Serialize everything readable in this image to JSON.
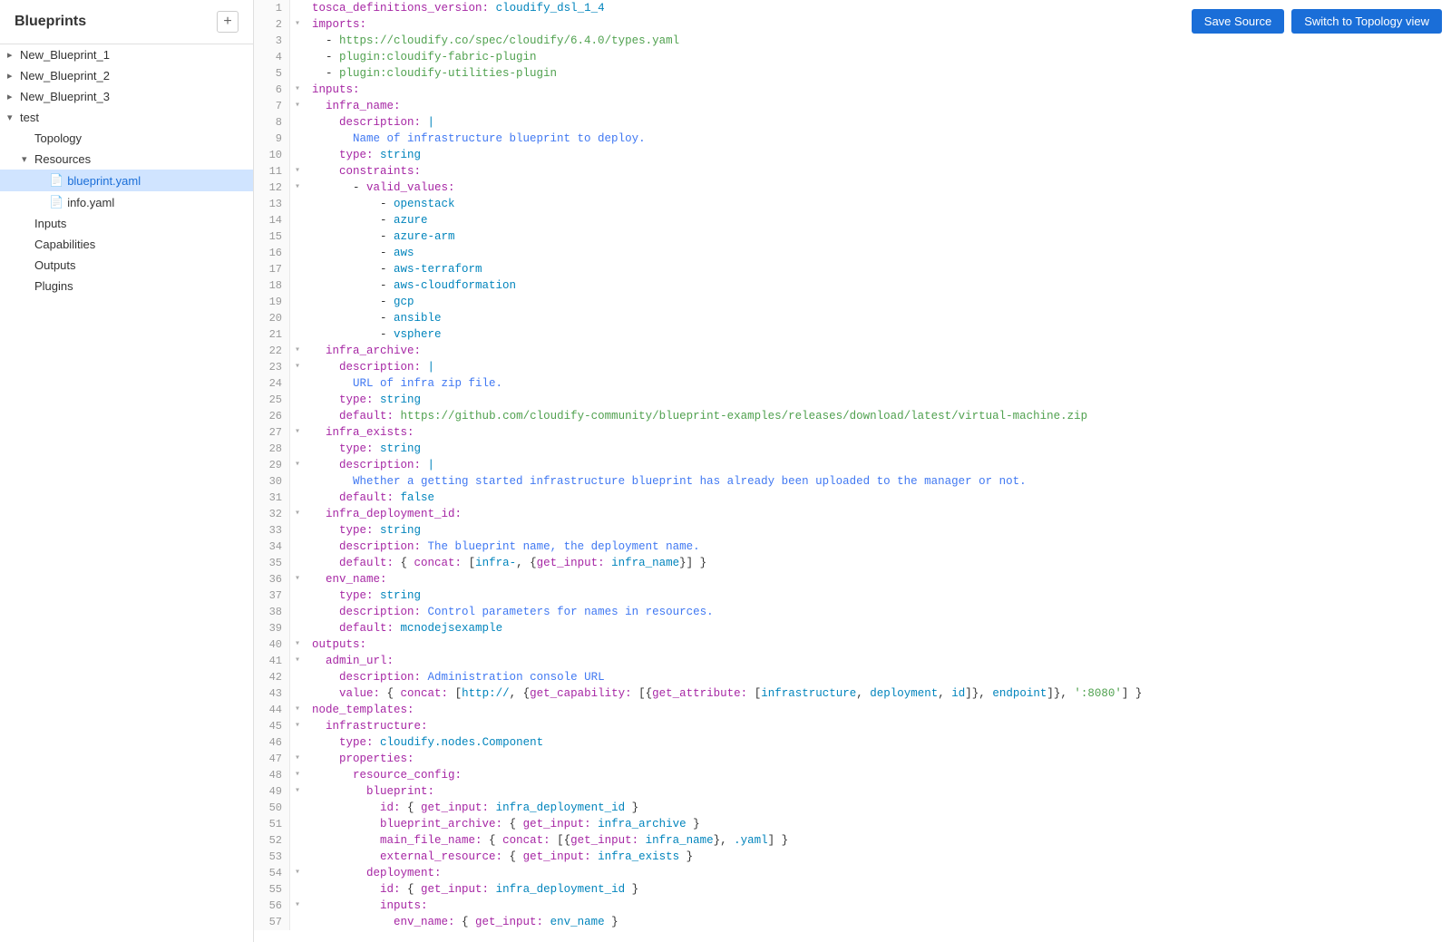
{
  "sidebar": {
    "title": "Blueprints",
    "add_label": "+",
    "items": [
      {
        "id": "new-bp-1",
        "label": "New_Blueprint_1",
        "level": 0,
        "expanded": false,
        "type": "blueprint"
      },
      {
        "id": "new-bp-2",
        "label": "New_Blueprint_2",
        "level": 0,
        "expanded": false,
        "type": "blueprint"
      },
      {
        "id": "new-bp-3",
        "label": "New_Blueprint_3",
        "level": 0,
        "expanded": false,
        "type": "blueprint"
      },
      {
        "id": "test",
        "label": "test",
        "level": 0,
        "expanded": true,
        "type": "blueprint"
      },
      {
        "id": "topology",
        "label": "Topology",
        "level": 1,
        "type": "page"
      },
      {
        "id": "resources",
        "label": "Resources",
        "level": 1,
        "expanded": true,
        "type": "folder"
      },
      {
        "id": "blueprint-yaml",
        "label": "blueprint.yaml",
        "level": 2,
        "type": "file",
        "selected": true
      },
      {
        "id": "info-yaml",
        "label": "info.yaml",
        "level": 2,
        "type": "file"
      },
      {
        "id": "inputs",
        "label": "Inputs",
        "level": 1,
        "type": "page"
      },
      {
        "id": "capabilities",
        "label": "Capabilities",
        "level": 1,
        "type": "page"
      },
      {
        "id": "outputs",
        "label": "Outputs",
        "level": 1,
        "type": "page"
      },
      {
        "id": "plugins",
        "label": "Plugins",
        "level": 1,
        "type": "page"
      }
    ]
  },
  "toolbar": {
    "save_label": "Save Source",
    "topology_label": "Switch to Topology view"
  },
  "code": {
    "lines": [
      {
        "n": 1,
        "fold": false,
        "text": "tosca_definitions_version: cloudify_dsl_1_4",
        "html": "<span class='kw'>tosca_definitions_version:</span> <span class='val'>cloudify_dsl_1_4</span>"
      },
      {
        "n": 2,
        "fold": true,
        "text": "imports:",
        "html": "<span class='kw'>imports:</span>"
      },
      {
        "n": 3,
        "fold": false,
        "text": "  - https://cloudify.co/spec/cloudify/6.4.0/types.yaml",
        "html": "  - <span class='str'>https://cloudify.co/spec/cloudify/6.4.0/types.yaml</span>"
      },
      {
        "n": 4,
        "fold": false,
        "text": "  - plugin:cloudify-fabric-plugin",
        "html": "  - <span class='str'>plugin:cloudify-fabric-plugin</span>"
      },
      {
        "n": 5,
        "fold": false,
        "text": "  - plugin:cloudify-utilities-plugin",
        "html": "  - <span class='str'>plugin:cloudify-utilities-plugin</span>"
      },
      {
        "n": 6,
        "fold": true,
        "text": "inputs:",
        "html": "<span class='kw'>inputs:</span>"
      },
      {
        "n": 7,
        "fold": true,
        "text": "  infra_name:",
        "html": "  <span class='kw'>infra_name:</span>"
      },
      {
        "n": 8,
        "fold": false,
        "text": "    description: |",
        "html": "    <span class='kw'>description:</span> <span class='val'>|</span>"
      },
      {
        "n": 9,
        "fold": false,
        "text": "      Name of infrastructure blueprint to deploy.",
        "html": "      <span class='blue'>Name of infrastructure blueprint to deploy.</span>"
      },
      {
        "n": 10,
        "fold": false,
        "text": "    type: string",
        "html": "    <span class='kw'>type:</span> <span class='val'>string</span>"
      },
      {
        "n": 11,
        "fold": true,
        "text": "    constraints:",
        "html": "    <span class='kw'>constraints:</span>"
      },
      {
        "n": 12,
        "fold": true,
        "text": "      - valid_values:",
        "html": "      - <span class='kw'>valid_values:</span>"
      },
      {
        "n": 13,
        "fold": false,
        "text": "          - openstack",
        "html": "          - <span class='val'>openstack</span>"
      },
      {
        "n": 14,
        "fold": false,
        "text": "          - azure",
        "html": "          - <span class='val'>azure</span>"
      },
      {
        "n": 15,
        "fold": false,
        "text": "          - azure-arm",
        "html": "          - <span class='val'>azure-arm</span>"
      },
      {
        "n": 16,
        "fold": false,
        "text": "          - aws",
        "html": "          - <span class='val'>aws</span>"
      },
      {
        "n": 17,
        "fold": false,
        "text": "          - aws-terraform",
        "html": "          - <span class='val'>aws-terraform</span>"
      },
      {
        "n": 18,
        "fold": false,
        "text": "          - aws-cloudformation",
        "html": "          - <span class='val'>aws-cloudformation</span>"
      },
      {
        "n": 19,
        "fold": false,
        "text": "          - gcp",
        "html": "          - <span class='val'>gcp</span>"
      },
      {
        "n": 20,
        "fold": false,
        "text": "          - ansible",
        "html": "          - <span class='val'>ansible</span>"
      },
      {
        "n": 21,
        "fold": false,
        "text": "          - vsphere",
        "html": "          - <span class='val'>vsphere</span>"
      },
      {
        "n": 22,
        "fold": true,
        "text": "  infra_archive:",
        "html": "  <span class='kw'>infra_archive:</span>"
      },
      {
        "n": 23,
        "fold": true,
        "text": "    description: |",
        "html": "    <span class='kw'>description:</span> <span class='val'>|</span>"
      },
      {
        "n": 24,
        "fold": false,
        "text": "      URL of infra zip file.",
        "html": "      <span class='blue'>URL of infra zip file.</span>"
      },
      {
        "n": 25,
        "fold": false,
        "text": "    type: string",
        "html": "    <span class='kw'>type:</span> <span class='val'>string</span>"
      },
      {
        "n": 26,
        "fold": false,
        "text": "    default: https://github.com/cloudify-community/blueprint-examples/releases/download/latest/virtual-machine.zip",
        "html": "    <span class='kw'>default:</span> <span class='str'>https://github.com/cloudify-community/blueprint-examples/releases/download/latest/virtual-machine.zip</span>"
      },
      {
        "n": 27,
        "fold": true,
        "text": "  infra_exists:",
        "html": "  <span class='kw'>infra_exists:</span>"
      },
      {
        "n": 28,
        "fold": false,
        "text": "    type: string",
        "html": "    <span class='kw'>type:</span> <span class='val'>string</span>"
      },
      {
        "n": 29,
        "fold": true,
        "text": "    description: |",
        "html": "    <span class='kw'>description:</span> <span class='val'>|</span>"
      },
      {
        "n": 30,
        "fold": false,
        "text": "      Whether a getting started infrastructure blueprint has already been uploaded to the manager or not.",
        "html": "      <span class='blue'>Whether a getting started infrastructure blueprint has already been uploaded to the manager or not.</span>"
      },
      {
        "n": 31,
        "fold": false,
        "text": "    default: false",
        "html": "    <span class='kw'>default:</span> <span class='val'>false</span>"
      },
      {
        "n": 32,
        "fold": true,
        "text": "  infra_deployment_id:",
        "html": "  <span class='kw'>infra_deployment_id:</span>"
      },
      {
        "n": 33,
        "fold": false,
        "text": "    type: string",
        "html": "    <span class='kw'>type:</span> <span class='val'>string</span>"
      },
      {
        "n": 34,
        "fold": false,
        "text": "    description: The blueprint name, the deployment name.",
        "html": "    <span class='kw'>description:</span> <span class='blue'>The blueprint name, the deployment name.</span>"
      },
      {
        "n": 35,
        "fold": false,
        "text": "    default: { concat: [infra-, {get_input: infra_name}] }",
        "html": "    <span class='kw'>default:</span> { <span class='kw'>concat:</span> [<span class='val'>infra-</span>, {<span class='kw'>get_input:</span> <span class='val'>infra_name</span>}] }"
      },
      {
        "n": 36,
        "fold": true,
        "text": "  env_name:",
        "html": "  <span class='kw'>env_name:</span>"
      },
      {
        "n": 37,
        "fold": false,
        "text": "    type: string",
        "html": "    <span class='kw'>type:</span> <span class='val'>string</span>"
      },
      {
        "n": 38,
        "fold": false,
        "text": "    description: Control parameters for names in resources.",
        "html": "    <span class='kw'>description:</span> <span class='blue'>Control parameters for names in resources.</span>"
      },
      {
        "n": 39,
        "fold": false,
        "text": "    default: mcnodejsexample",
        "html": "    <span class='kw'>default:</span> <span class='val'>mcnodejsexample</span>"
      },
      {
        "n": 40,
        "fold": true,
        "text": "outputs:",
        "html": "<span class='kw'>outputs:</span>"
      },
      {
        "n": 41,
        "fold": true,
        "text": "  admin_url:",
        "html": "  <span class='kw'>admin_url:</span>"
      },
      {
        "n": 42,
        "fold": false,
        "text": "    description: Administration console URL",
        "html": "    <span class='kw'>description:</span> <span class='blue'>Administration console URL</span>"
      },
      {
        "n": 43,
        "fold": false,
        "text": "    value: { concat: [http://, {get_capability: [{get_attribute: [infrastructure, deployment, id]}, endpoint]}, ':8080'] }",
        "html": "    <span class='kw'>value:</span> { <span class='kw'>concat:</span> [<span class='val'>http://</span>, {<span class='kw'>get_capability:</span> [{<span class='kw'>get_attribute:</span> [<span class='val'>infrastructure</span>, <span class='val'>deployment</span>, <span class='val'>id</span>]}, <span class='val'>endpoint</span>]}, <span class='str'>':8080'</span>] }"
      },
      {
        "n": 44,
        "fold": true,
        "text": "node_templates:",
        "html": "<span class='kw'>node_templates:</span>"
      },
      {
        "n": 45,
        "fold": true,
        "text": "  infrastructure:",
        "html": "  <span class='kw'>infrastructure:</span>"
      },
      {
        "n": 46,
        "fold": false,
        "text": "    type: cloudify.nodes.Component",
        "html": "    <span class='kw'>type:</span> <span class='val'>cloudify.nodes.Component</span>"
      },
      {
        "n": 47,
        "fold": true,
        "text": "    properties:",
        "html": "    <span class='kw'>properties:</span>"
      },
      {
        "n": 48,
        "fold": true,
        "text": "      resource_config:",
        "html": "      <span class='kw'>resource_config:</span>"
      },
      {
        "n": 49,
        "fold": true,
        "text": "        blueprint:",
        "html": "        <span class='kw'>blueprint:</span>"
      },
      {
        "n": 50,
        "fold": false,
        "text": "          id: { get_input: infra_deployment_id }",
        "html": "          <span class='kw'>id:</span> { <span class='kw'>get_input:</span> <span class='val'>infra_deployment_id</span> }"
      },
      {
        "n": 51,
        "fold": false,
        "text": "          blueprint_archive: { get_input: infra_archive }",
        "html": "          <span class='kw'>blueprint_archive:</span> { <span class='kw'>get_input:</span> <span class='val'>infra_archive</span> }"
      },
      {
        "n": 52,
        "fold": false,
        "text": "          main_file_name: { concat: [{get_input: infra_name}, .yaml] }",
        "html": "          <span class='kw'>main_file_name:</span> { <span class='kw'>concat:</span> [{<span class='kw'>get_input:</span> <span class='val'>infra_name</span>}, <span class='val'>.yaml</span>] }"
      },
      {
        "n": 53,
        "fold": false,
        "text": "          external_resource: { get_input: infra_exists }",
        "html": "          <span class='kw'>external_resource:</span> { <span class='kw'>get_input:</span> <span class='val'>infra_exists</span> }"
      },
      {
        "n": 54,
        "fold": true,
        "text": "        deployment:",
        "html": "        <span class='kw'>deployment:</span>"
      },
      {
        "n": 55,
        "fold": false,
        "text": "          id: { get_input: infra_deployment_id }",
        "html": "          <span class='kw'>id:</span> { <span class='kw'>get_input:</span> <span class='val'>infra_deployment_id</span> }"
      },
      {
        "n": 56,
        "fold": true,
        "text": "          inputs:",
        "html": "          <span class='kw'>inputs:</span>"
      },
      {
        "n": 57,
        "fold": false,
        "text": "            env_name: { get_input: env_name }",
        "html": "            <span class='kw'>env_name:</span> { <span class='kw'>get_input:</span> <span class='val'>env_name</span> }"
      }
    ]
  }
}
